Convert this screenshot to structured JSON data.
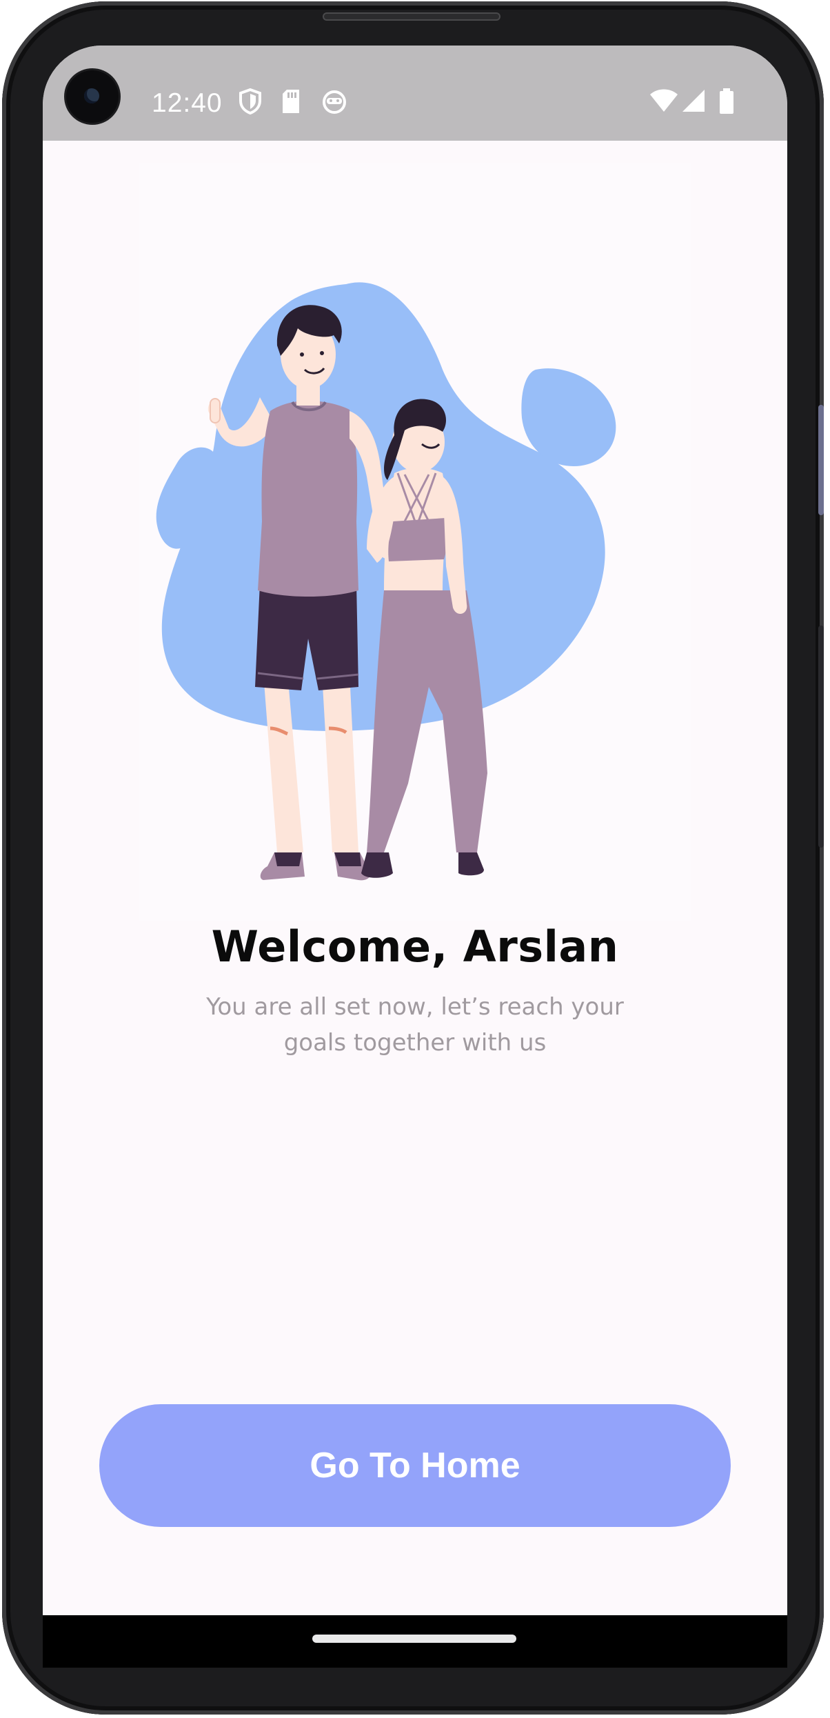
{
  "status_bar": {
    "time": "12:40",
    "left_icons": [
      "shield-icon",
      "sd-card-icon",
      "android-face-icon"
    ],
    "right_icons": [
      "wifi-icon",
      "cellular-signal-icon",
      "battery-icon"
    ]
  },
  "welcome": {
    "title": "Welcome, Arslan",
    "subtitle_line1": "You are all set now, let’s reach your",
    "subtitle_line2": "goals together with us"
  },
  "actions": {
    "home_button_label": "Go To Home"
  },
  "colors": {
    "button": "#93a3fa",
    "blob": "#98bef8",
    "status_bar": "#bdbbbd",
    "background": "#fdf9fc"
  }
}
